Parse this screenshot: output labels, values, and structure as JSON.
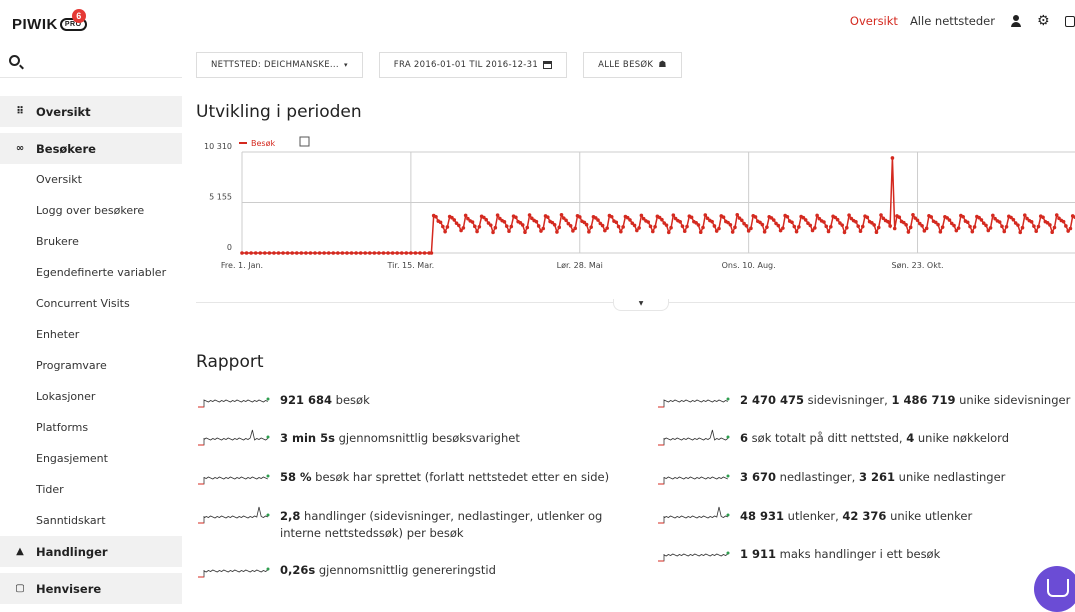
{
  "header": {
    "logo_text": "PIWIK",
    "logo_pro": "PRO",
    "notification_count": "6",
    "nav_overview": "Oversikt",
    "nav_all_sites": "Alle nettsteder"
  },
  "sidebar": {
    "sections": [
      {
        "label": "Oversikt",
        "icon": "grid-icon"
      },
      {
        "label": "Besøkere",
        "icon": "binoculars-icon"
      }
    ],
    "visitors_items": [
      "Oversikt",
      "Logg over besøkere",
      "Brukere",
      "Egendefinerte variabler",
      "Concurrent Visits",
      "Enheter",
      "Programvare",
      "Lokasjoner",
      "Platforms",
      "Engasjement",
      "Tider",
      "Sanntidskart"
    ],
    "bottom_sections": [
      {
        "label": "Handlinger",
        "icon": "bell-icon"
      },
      {
        "label": "Henvisere",
        "icon": "window-icon"
      }
    ]
  },
  "filters": {
    "site": "NETTSTED: DEICHMANSKE...",
    "period": "FRA 2016-01-01 TIL 2016-12-31",
    "segment": "ALLE BESØK"
  },
  "evolution": {
    "title": "Utvikling i perioden",
    "legend": "Besøk",
    "accent": "#d4291f"
  },
  "chart_data": {
    "type": "line",
    "title": "Utvikling i perioden",
    "series_name": "Besøk",
    "yticks": [
      "10 310",
      "5 155",
      "0"
    ],
    "ylim": [
      0,
      10310
    ],
    "xticks": [
      "Fre. 1. Jan.",
      "Tir. 15. Mar.",
      "Lør. 28. Mai",
      "Ons. 10. Aug.",
      "Søn. 23. Okt."
    ],
    "xtick_days": [
      0,
      74,
      148,
      222,
      296
    ],
    "x_range_days": [
      0,
      365
    ],
    "segments": [
      {
        "from_day": 0,
        "to_day": 82,
        "value": 0
      },
      {
        "from_day": 84,
        "to_day": 365,
        "weekly_pattern": [
          3800,
          3600,
          3300,
          3100,
          2800,
          2200,
          2600
        ],
        "peak_day": 285,
        "peak_value": 9700
      }
    ],
    "color": "#d4291f",
    "grid": true
  },
  "report": {
    "title": "Rapport",
    "left": [
      {
        "bold": "921 684",
        "text": " besøk"
      },
      {
        "bold": "3 min 5s",
        "text": " gjennomsnittlig besøksvarighet"
      },
      {
        "bold": "58 %",
        "text": " besøk har sprettet (forlatt nettstedet etter en side)"
      },
      {
        "bold": "2,8",
        "text": " handlinger (sidevisninger, nedlastinger, utlenker og interne nettstedssøk) per besøk"
      },
      {
        "bold": "0,26s",
        "text": " gjennomsnittlig genereringstid"
      }
    ],
    "right": [
      {
        "bold": "2 470 475",
        "text": " sidevisninger, ",
        "bold2": "1 486 719",
        "text2": " unike sidevisninger"
      },
      {
        "bold": "6",
        "text": " søk totalt på ditt nettsted, ",
        "bold2": "4",
        "text2": " unike nøkkelord"
      },
      {
        "bold": "3 670",
        "text": " nedlastinger, ",
        "bold2": "3 261",
        "text2": " unike nedlastinger"
      },
      {
        "bold": "48 931",
        "text": " utlenker, ",
        "bold2": "42 376",
        "text2": " unike utlenker"
      },
      {
        "bold": "1 911",
        "text": " maks handlinger i ett besøk",
        "bold2": "",
        "text2": ""
      }
    ]
  }
}
